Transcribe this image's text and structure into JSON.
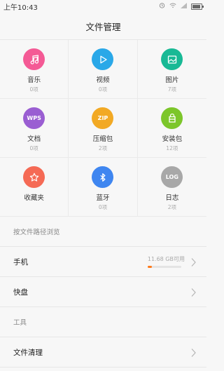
{
  "status_bar": {
    "time": "上午10:43"
  },
  "header": {
    "title": "文件管理"
  },
  "categories": [
    {
      "label": "音乐",
      "count": "0项",
      "color": "#f45a95",
      "icon": "music-note-icon"
    },
    {
      "label": "视频",
      "count": "0项",
      "color": "#2aa8e8",
      "icon": "play-icon"
    },
    {
      "label": "图片",
      "count": "7项",
      "color": "#18b995",
      "icon": "image-icon"
    },
    {
      "label": "文档",
      "count": "0项",
      "color": "#9a5ed2",
      "icon": "wps-icon",
      "icon_text": "WPS"
    },
    {
      "label": "压缩包",
      "count": "2项",
      "color": "#f2a924",
      "icon": "zip-icon",
      "icon_text": "ZIP"
    },
    {
      "label": "安装包",
      "count": "12项",
      "color": "#7cc62a",
      "icon": "package-icon"
    },
    {
      "label": "收藏夹",
      "count": "",
      "color": "#f56a55",
      "icon": "star-icon"
    },
    {
      "label": "蓝牙",
      "count": "0项",
      "color": "#3f86f0",
      "icon": "bluetooth-icon"
    },
    {
      "label": "日志",
      "count": "2项",
      "color": "#a8a8a8",
      "icon": "log-icon",
      "icon_text": "LOG"
    }
  ],
  "browse_section": {
    "label": "按文件路径浏览",
    "items": [
      {
        "title": "手机",
        "storage_text": "11.68 GB可用",
        "usage_fraction": 0.12
      },
      {
        "title": "快盘"
      }
    ]
  },
  "tools_section": {
    "label": "工具",
    "items": [
      {
        "title": "文件清理"
      }
    ]
  }
}
